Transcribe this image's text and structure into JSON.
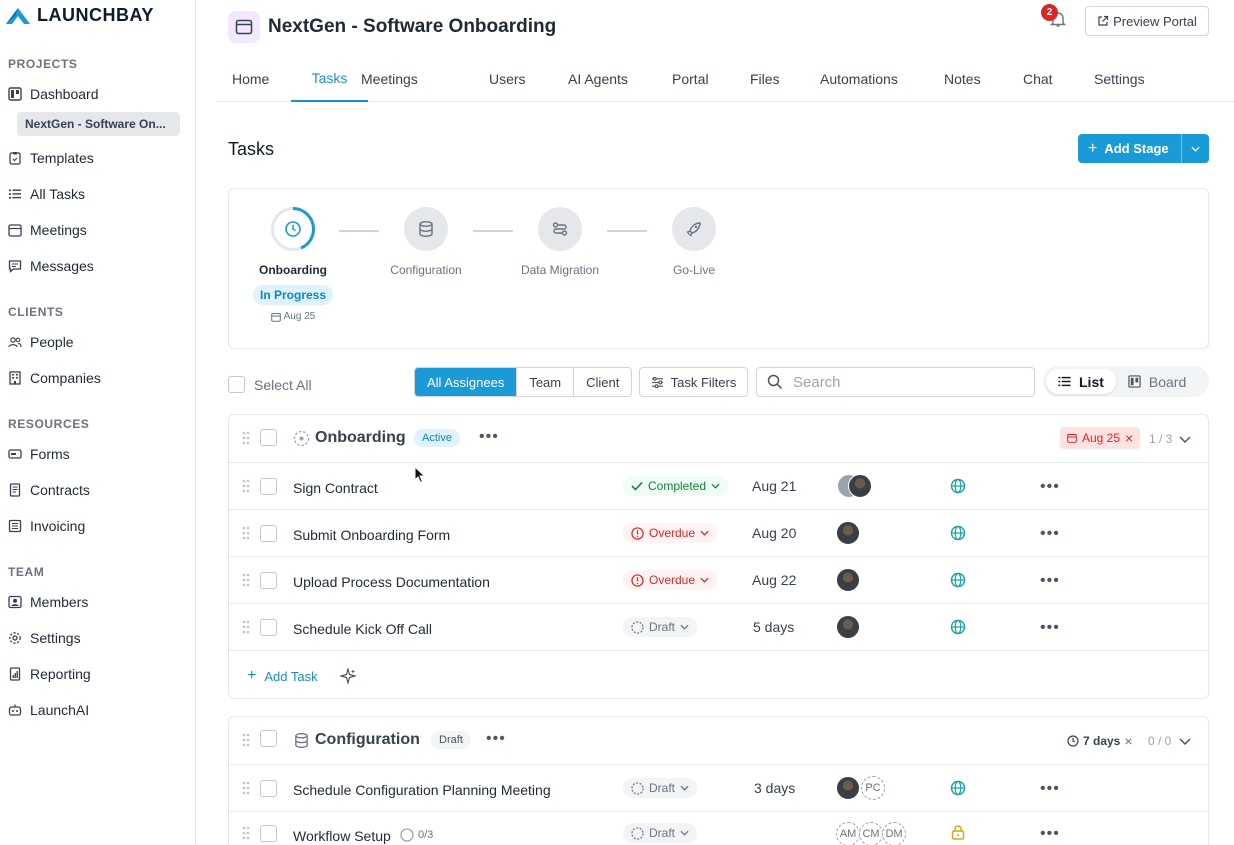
{
  "app": {
    "logo_text": "LAUNCHBAY"
  },
  "sidebar": {
    "sections": [
      {
        "title": "PROJECTS"
      },
      {
        "title": "CLIENTS"
      },
      {
        "title": "RESOURCES"
      },
      {
        "title": "TEAM"
      }
    ],
    "items": [
      {
        "label": "Dashboard",
        "icon": "dashboard-icon"
      },
      {
        "label": "Templates",
        "icon": "clipboard-icon"
      },
      {
        "label": "All Tasks",
        "icon": "list-icon"
      },
      {
        "label": "Meetings",
        "icon": "calendar-icon"
      },
      {
        "label": "Messages",
        "icon": "message-icon"
      },
      {
        "label": "People",
        "icon": "people-icon"
      },
      {
        "label": "Companies",
        "icon": "building-icon"
      },
      {
        "label": "Forms",
        "icon": "form-icon"
      },
      {
        "label": "Contracts",
        "icon": "document-icon"
      },
      {
        "label": "Invoicing",
        "icon": "invoice-icon"
      },
      {
        "label": "Members",
        "icon": "member-icon"
      },
      {
        "label": "Settings",
        "icon": "gear-icon"
      },
      {
        "label": "Reporting",
        "icon": "report-icon"
      },
      {
        "label": "LaunchAI",
        "icon": "robot-icon"
      }
    ],
    "current_project": "NextGen - Software On..."
  },
  "header": {
    "project_title": "NextGen - Software Onboarding",
    "notifications_count": "2",
    "preview_label": "Preview Portal"
  },
  "tabs": [
    "Home",
    "Tasks",
    "Meetings",
    "Users",
    "AI Agents",
    "Portal",
    "Files",
    "Automations",
    "Notes",
    "Chat",
    "Settings"
  ],
  "main": {
    "title": "Tasks",
    "add_stage_label": "Add Stage"
  },
  "stages": [
    {
      "name": "Onboarding",
      "status": "In Progress",
      "date": "Aug 25",
      "icon": "clock-icon"
    },
    {
      "name": "Configuration",
      "icon": "database-icon"
    },
    {
      "name": "Data Migration",
      "icon": "migration-icon"
    },
    {
      "name": "Go-Live",
      "icon": "rocket-icon"
    }
  ],
  "toolbar": {
    "select_all": "Select All",
    "assignee_filters": [
      "All Assignees",
      "Team",
      "Client"
    ],
    "task_filters": "Task Filters",
    "search_placeholder": "Search",
    "view_list": "List",
    "view_board": "Board"
  },
  "groups": [
    {
      "name": "Onboarding",
      "badge": "Active",
      "due": "Aug 25",
      "count": "1 / 3",
      "tasks": [
        {
          "name": "Sign Contract",
          "status": "Completed",
          "date": "Aug 21"
        },
        {
          "name": "Submit Onboarding Form",
          "status": "Overdue",
          "date": "Aug 20"
        },
        {
          "name": "Upload Process Documentation",
          "status": "Overdue",
          "date": "Aug 22"
        },
        {
          "name": "Schedule Kick Off Call",
          "status": "Draft",
          "date": "5 days"
        }
      ],
      "add_task": "Add Task"
    },
    {
      "name": "Configuration",
      "badge": "Draft",
      "duration": "7 days",
      "count": "0 / 0",
      "tasks": [
        {
          "name": "Schedule Configuration Planning Meeting",
          "status": "Draft",
          "date": "3 days",
          "initials": [
            "PC"
          ]
        },
        {
          "name": "Workflow Setup",
          "subtasks": "0/3",
          "status": "Draft",
          "initials": [
            "AM",
            "CM",
            "DM"
          ]
        }
      ]
    }
  ]
}
